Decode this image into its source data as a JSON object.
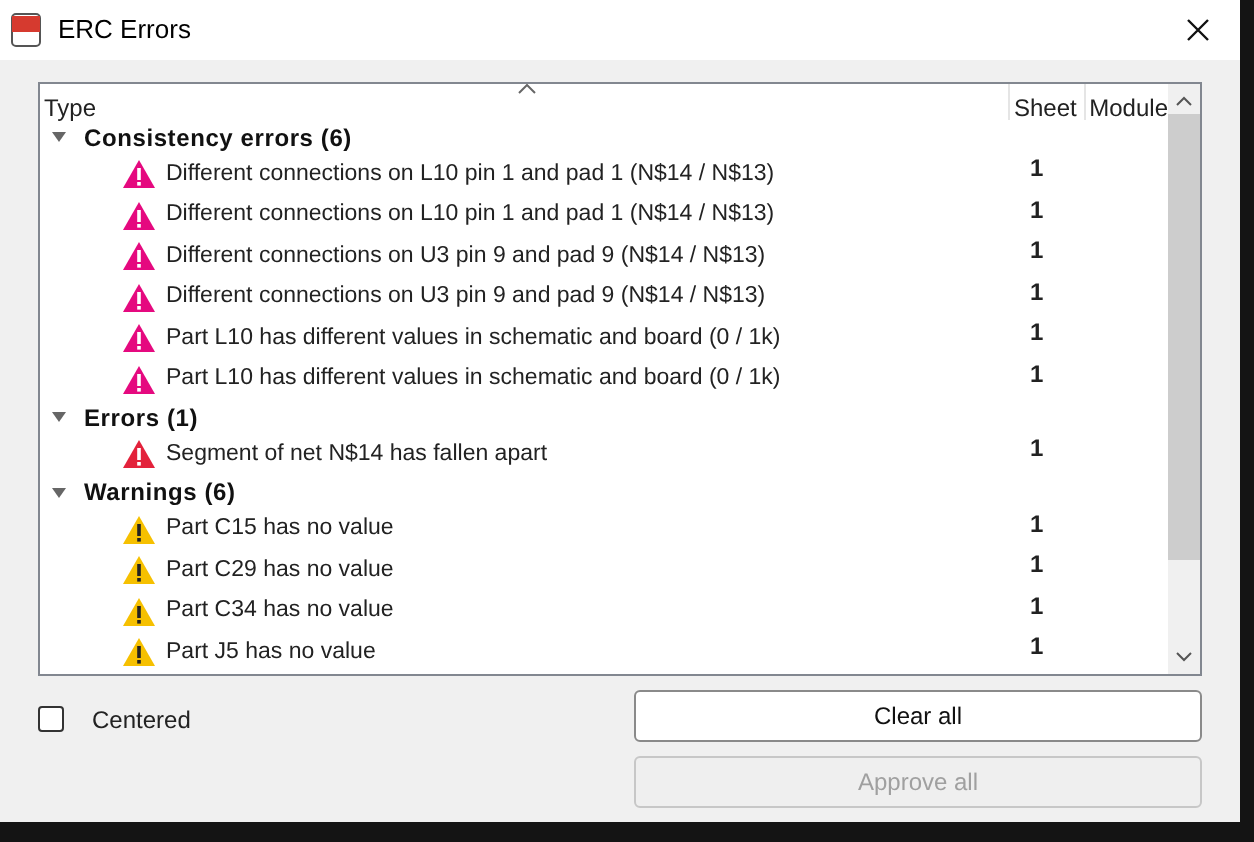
{
  "window": {
    "title": "ERC Errors"
  },
  "table": {
    "columns": [
      "Type",
      "Sheet",
      "Module"
    ],
    "groups": [
      {
        "label": "Consistency errors (6)",
        "expanded": true,
        "items": [
          {
            "kind": "consistency",
            "text": "Different connections on L10 pin 1 and pad 1 (N$14 / N$13)",
            "sheet": "1"
          },
          {
            "kind": "consistency",
            "text": "Different connections on L10 pin 1 and pad 1 (N$14 / N$13)",
            "sheet": "1"
          },
          {
            "kind": "consistency",
            "text": "Different connections on U3 pin 9 and pad 9 (N$14 / N$13)",
            "sheet": "1"
          },
          {
            "kind": "consistency",
            "text": "Different connections on U3 pin 9 and pad 9 (N$14 / N$13)",
            "sheet": "1"
          },
          {
            "kind": "consistency",
            "text": "Part L10 has different values in schematic and board (0 / 1k)",
            "sheet": "1"
          },
          {
            "kind": "consistency",
            "text": "Part L10 has different values in schematic and board (0 / 1k)",
            "sheet": "1"
          }
        ]
      },
      {
        "label": "Errors (1)",
        "expanded": true,
        "items": [
          {
            "kind": "error",
            "text": "Segment of net N$14 has fallen apart",
            "sheet": "1"
          }
        ]
      },
      {
        "label": "Warnings (6)",
        "expanded": true,
        "items": [
          {
            "kind": "warning",
            "text": "Part C15 has no value",
            "sheet": "1"
          },
          {
            "kind": "warning",
            "text": "Part C29 has no value",
            "sheet": "1"
          },
          {
            "kind": "warning",
            "text": "Part C34 has no value",
            "sheet": "1"
          },
          {
            "kind": "warning",
            "text": "Part J5 has no value",
            "sheet": "1"
          }
        ]
      }
    ]
  },
  "centered": {
    "label": "Centered",
    "checked": false
  },
  "buttons": [
    {
      "label": "Clear all",
      "disabled": false
    },
    {
      "label": "Approve all",
      "disabled": true
    }
  ]
}
